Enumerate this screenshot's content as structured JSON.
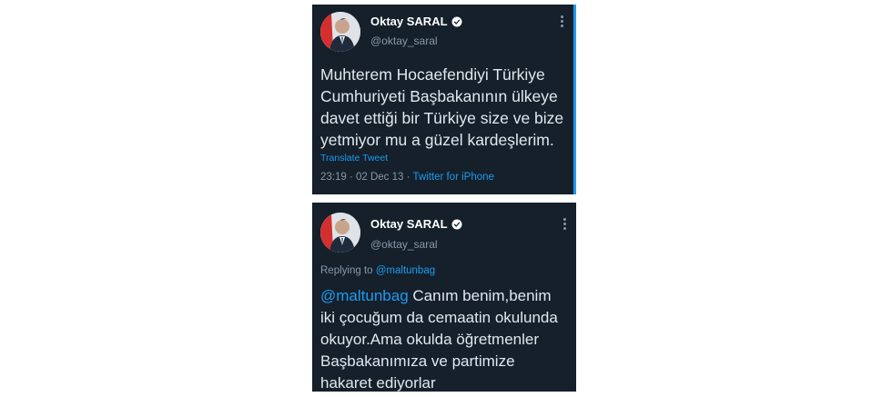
{
  "tweets": [
    {
      "name": "Oktay SARAL",
      "handle": "@oktay_saral",
      "text": "Muhterem Hocaefendiyi Türkiye Cumhuriyeti Başbakanının ülkeye davet ettiği bir Türkiye size ve bize yetmiyor mu a güzel kardeşlerim.",
      "translate_label": "Translate Tweet",
      "time": "23:19 · 02 Dec 13 · ",
      "source": "Twitter for iPhone"
    },
    {
      "name": "Oktay SARAL",
      "handle": "@oktay_saral",
      "replying_prefix": "Replying to ",
      "replying_to": "@maltunbag",
      "mention": "@maltunbag",
      "text": " Canım benim,benim iki çocuğum da cemaatin okulunda okuyor.Ama okulda öğretmenler Başbakanımıza ve partimize hakaret ediyorlar"
    }
  ],
  "colors": {
    "card_bg": "#15202b",
    "accent": "#1d9bf0",
    "muted": "#8899a6"
  },
  "icons": [
    "avatar",
    "verified-badge-icon",
    "more-options-icon"
  ]
}
